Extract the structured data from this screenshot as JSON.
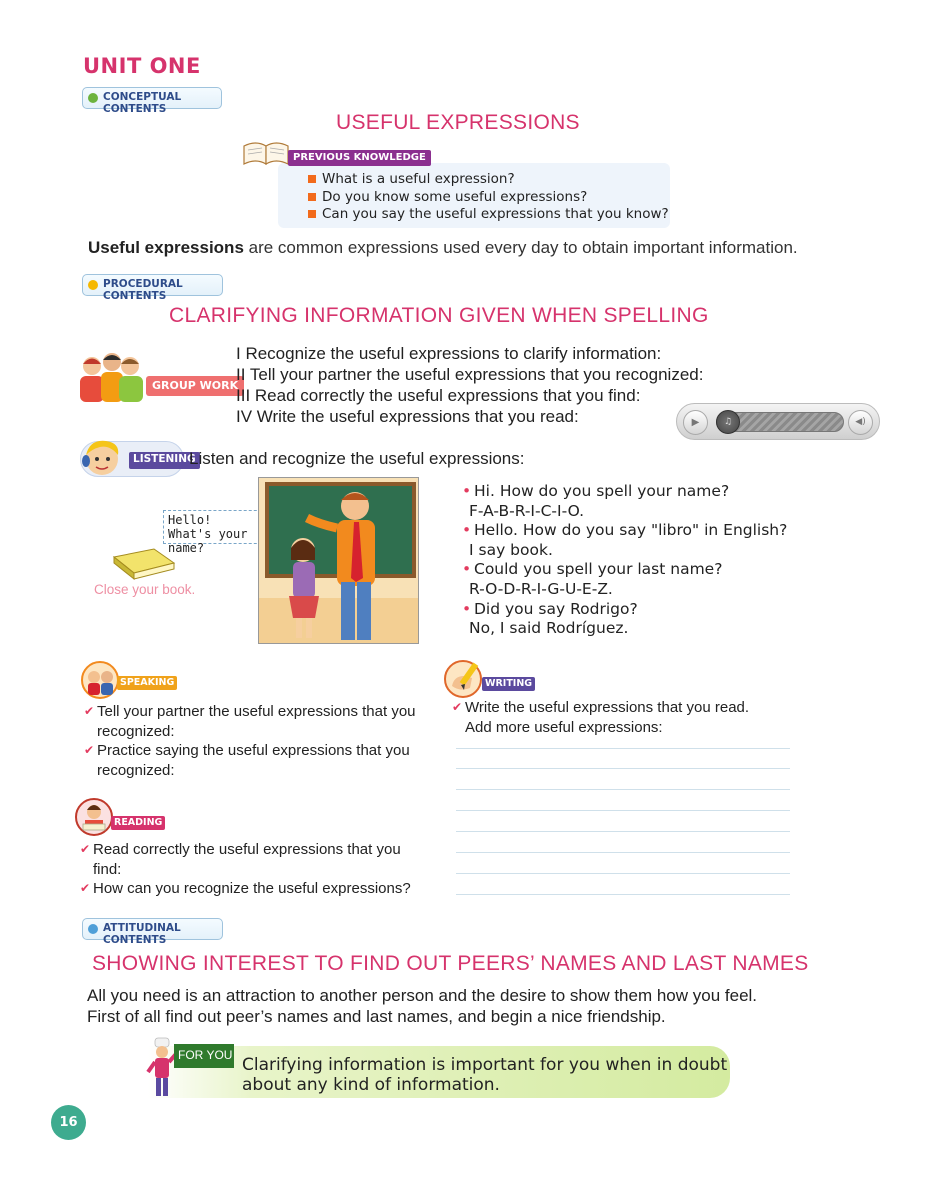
{
  "unit_title": "UNIT ONE",
  "tags": {
    "conceptual": "CONCEPTUAL CONTENTS",
    "procedural": "PROCEDURAL CONTENTS",
    "attitudinal": "ATTITUDINAL CONTENTS"
  },
  "headings": {
    "useful_expressions": "USEFUL EXPRESSIONS",
    "clarifying": "CLARIFYING INFORMATION GIVEN WHEN SPELLING",
    "showing_interest": "SHOWING  INTEREST TO FIND OUT PEERS’ NAMES AND LAST NAMES"
  },
  "previous_knowledge": {
    "label": "PREVIOUS KNOWLEDGE",
    "items": [
      "What is a useful expression?",
      "Do you know some useful expressions?",
      "Can you say the useful expressions that you know?"
    ]
  },
  "intro": {
    "bold": "Useful expressions",
    "rest": " are common expressions used every day to obtain important information."
  },
  "group_work": {
    "label": "GROUP WORK",
    "steps": [
      "I   Recognize the useful expressions to clarify information:",
      "II  Tell your partner the useful expressions that you recognized:",
      "III Read correctly the useful expressions that you find:",
      "IV Write the useful expressions that you read:"
    ]
  },
  "listening": {
    "label": "LISTENING",
    "text": "Listen and recognize the useful expressions:",
    "bubble_line1": "Hello!",
    "bubble_line2": "What's your name?",
    "caption": "Close your book."
  },
  "dialogue": [
    {
      "q": "Hi. How do you spell your name?",
      "a": "F-A-B-R-I-C-I-O."
    },
    {
      "q": "Hello. How do you say \"libro\" in English?",
      "a": "I say book."
    },
    {
      "q": "Could you spell your last name?",
      "a": "R-O-D-R-I-G-U-E-Z."
    },
    {
      "q": "Did you say Rodrigo?",
      "a": "No, I said Rodríguez."
    }
  ],
  "speaking": {
    "label": "SPEAKING",
    "items": [
      "Tell your partner the useful expressions that you recognized:",
      "Practice saying the useful expressions that you recognized:"
    ]
  },
  "reading": {
    "label": "READING",
    "items": [
      "Read correctly the useful expressions that you find:",
      "How can you recognize the useful expressions?"
    ]
  },
  "writing": {
    "label": "WRITING",
    "line1": "Write the useful expressions that you read.",
    "line2": "Add more useful expressions:"
  },
  "attitudinal_text": {
    "line1": "All you need is an attraction to another person and the desire to show them how you feel.",
    "line2": "First of all find out peer’s names and last names, and begin a nice friendship."
  },
  "for_you": {
    "label": "FOR YOU",
    "line1": "Clarifying information is important for you when in doubt",
    "line2": "about  any kind of information."
  },
  "page_number": "16",
  "colors": {
    "accent_pink": "#d6336c",
    "procedural_dot": "#f5b800",
    "conceptual_dot": "#6cb33e",
    "attitudinal_dot": "#4f9fd8",
    "page_badge": "#3eab8f"
  },
  "icons": {
    "previous_knowledge": "open-book-icon",
    "group_work": "kids-group-icon",
    "listening": "listening-boy-icon",
    "speaking": "speaking-kids-icon",
    "reading": "reading-girl-icon",
    "writing": "hand-pencil-icon",
    "for_you": "chef-figure-icon",
    "audio_player": "audio-player-icon"
  }
}
